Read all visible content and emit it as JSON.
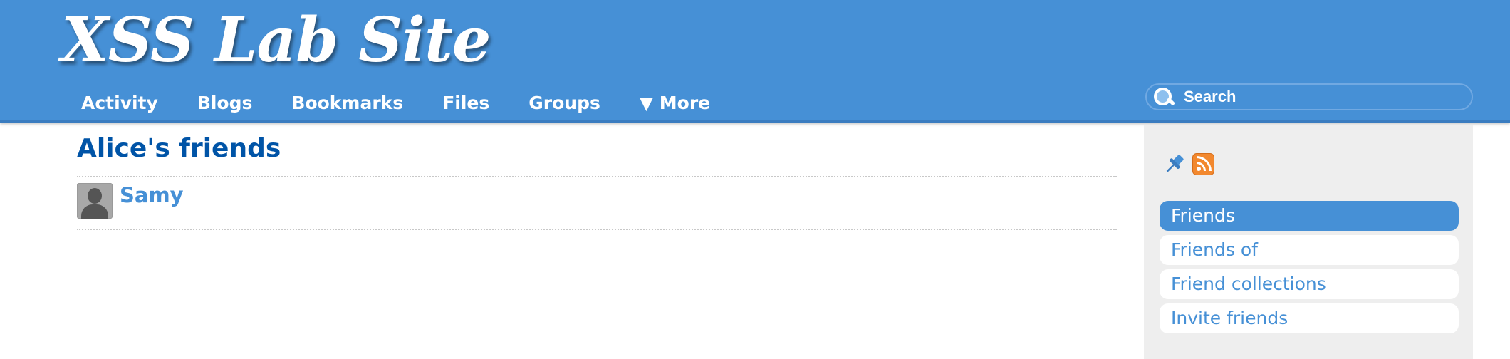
{
  "header": {
    "site_title": "XSS Lab Site",
    "nav": [
      {
        "label": "Activity"
      },
      {
        "label": "Blogs"
      },
      {
        "label": "Bookmarks"
      },
      {
        "label": "Files"
      },
      {
        "label": "Groups"
      },
      {
        "label": "▼ More"
      }
    ],
    "search": {
      "placeholder": "Search",
      "value": ""
    }
  },
  "main": {
    "title": "Alice's friends",
    "friends": [
      {
        "name": "Samy",
        "avatar_icon": "default-user-avatar-icon"
      }
    ]
  },
  "sidebar": {
    "icons": [
      "pin-icon",
      "rss-icon"
    ],
    "menu": [
      {
        "label": "Friends",
        "selected": true
      },
      {
        "label": "Friends of",
        "selected": false
      },
      {
        "label": "Friend collections",
        "selected": false
      },
      {
        "label": "Invite friends",
        "selected": false
      }
    ]
  },
  "colors": {
    "header_bg": "#4690d6",
    "title_text": "#0054a7",
    "link": "#4690d6",
    "sidebar_bg": "#eeeeee",
    "rss": "#f2882e"
  }
}
